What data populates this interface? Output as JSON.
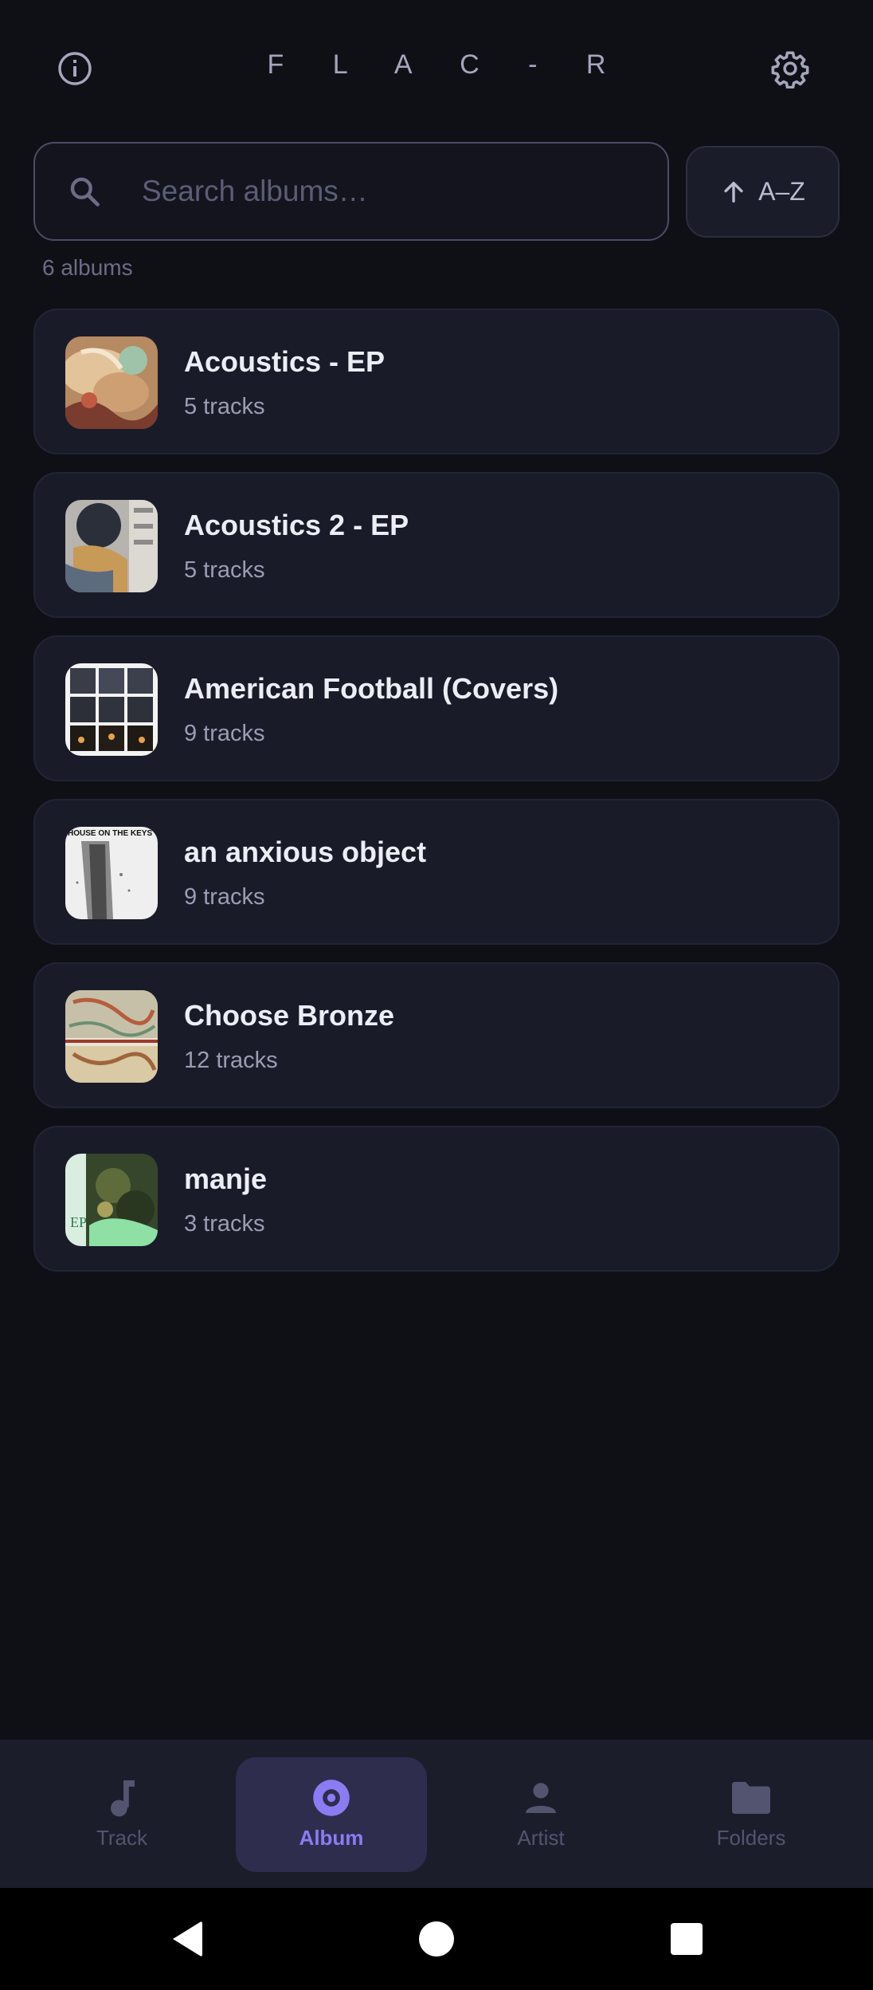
{
  "header": {
    "title": "F L A C - R",
    "info_icon": "info-icon",
    "settings_icon": "gear-icon"
  },
  "search": {
    "placeholder": "Search albums…",
    "value": ""
  },
  "sort": {
    "label": "A–Z",
    "icon": "arrow-up-icon"
  },
  "album_count": "6 albums",
  "albums": [
    {
      "title": "Acoustics - EP",
      "tracks": "5 tracks"
    },
    {
      "title": "Acoustics 2 - EP",
      "tracks": "5 tracks"
    },
    {
      "title": "American Football (Covers)",
      "tracks": "9 tracks"
    },
    {
      "title": "an anxious object",
      "tracks": "9 tracks",
      "art_text": "HOUSE ON THE KEYS"
    },
    {
      "title": "Choose Bronze",
      "tracks": "12 tracks"
    },
    {
      "title": "manje",
      "tracks": "3 tracks",
      "art_text": "EP"
    }
  ],
  "nav": {
    "items": [
      {
        "label": "Track",
        "icon": "music-note-icon",
        "active": false
      },
      {
        "label": "Album",
        "icon": "disc-icon",
        "active": true
      },
      {
        "label": "Artist",
        "icon": "person-icon",
        "active": false
      },
      {
        "label": "Folders",
        "icon": "folder-icon",
        "active": false
      }
    ]
  },
  "colors": {
    "background": "#0f1016",
    "card": "#1a1b29",
    "accent": "#8b7cf2",
    "nav_bar": "#1c1d2b"
  }
}
